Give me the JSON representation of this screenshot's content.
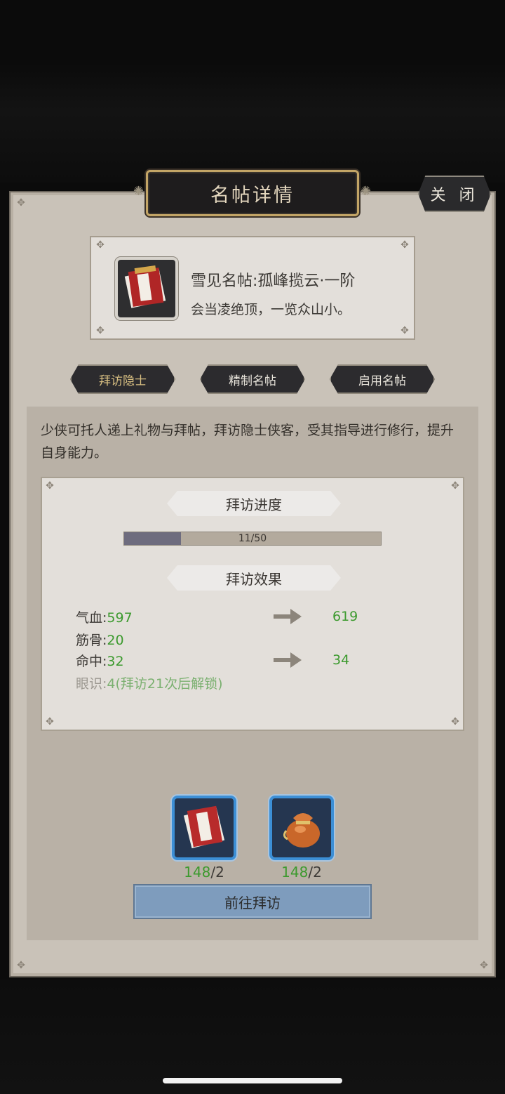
{
  "window": {
    "title": "名帖详情",
    "close_label": "关 闭"
  },
  "item": {
    "name": "雪见名帖:孤峰揽云·一阶",
    "desc": "会当凌绝顶，一览众山小。"
  },
  "tabs": [
    {
      "label": "拜访隐士",
      "active": true
    },
    {
      "label": "精制名帖",
      "active": false
    },
    {
      "label": "启用名帖",
      "active": false
    }
  ],
  "intro": "少侠可托人递上礼物与拜帖，拜访隐士侠客，受其指导进行修行，提升自身能力。",
  "progress": {
    "heading": "拜访进度",
    "current": 11,
    "total": 50,
    "label": "11/50",
    "fraction": 0.22
  },
  "effect": {
    "heading": "拜访效果",
    "stats": [
      {
        "name": "气血:",
        "value": "597",
        "next": "619"
      },
      {
        "name": "筋骨:",
        "value": "20",
        "next": ""
      },
      {
        "name": "命中:",
        "value": "32",
        "next": "34"
      },
      {
        "name": "眼识:",
        "value": "4(拜访21次后解锁)",
        "next": "",
        "locked": true
      }
    ]
  },
  "costs": [
    {
      "icon": "invitation-card-icon",
      "have": "148",
      "need": "/2"
    },
    {
      "icon": "gift-pouch-icon",
      "have": "148",
      "need": "/2"
    }
  ],
  "action_label": "前往拜访",
  "colors": {
    "accent_green": "#3c9a2e",
    "gold_border": "#c3a566",
    "button_blue": "#7e9cbd"
  }
}
